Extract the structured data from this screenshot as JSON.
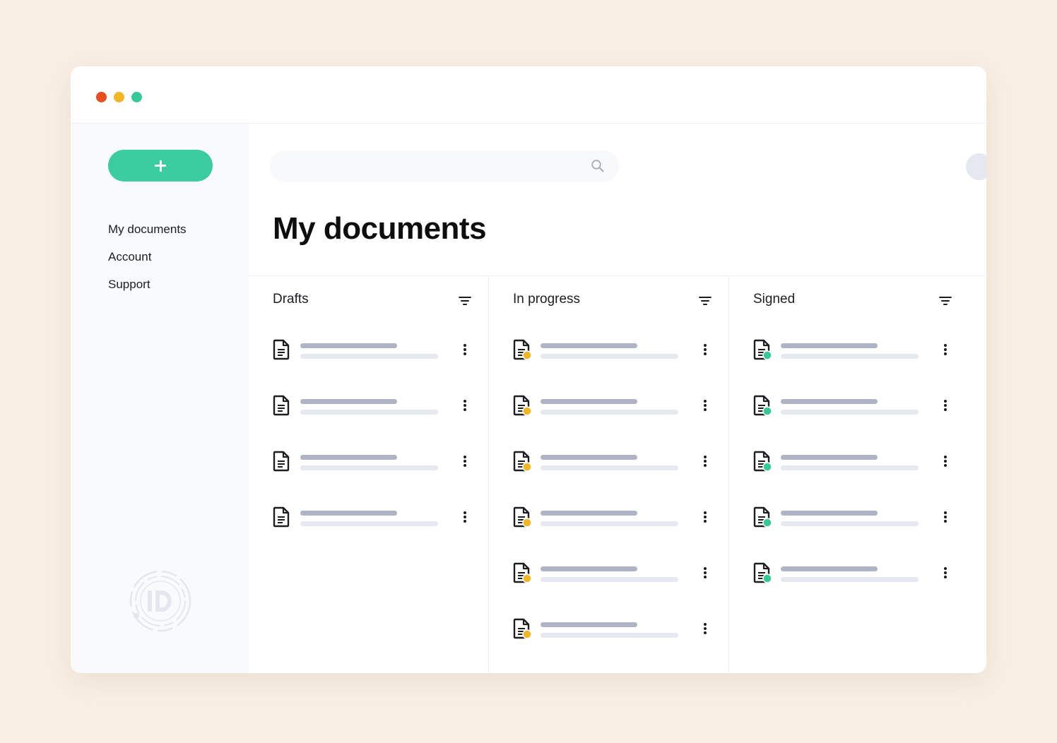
{
  "window": {
    "controls": [
      {
        "name": "close",
        "color": "#e84d1d"
      },
      {
        "name": "minimize",
        "color": "#f0b623"
      },
      {
        "name": "maximize",
        "color": "#35c997"
      }
    ]
  },
  "sidebar": {
    "new_button_icon": "plus-icon",
    "items": [
      {
        "label": "My documents"
      },
      {
        "label": "Account"
      },
      {
        "label": "Support"
      }
    ],
    "logo_icon": "id-logo-icon"
  },
  "header": {
    "search": {
      "placeholder": "",
      "value": "",
      "icon": "search-icon"
    },
    "notification_color": "#e84d1d"
  },
  "main": {
    "title": "My documents",
    "columns": [
      {
        "title": "Drafts",
        "status": "draft",
        "status_color": "",
        "row_count": 4
      },
      {
        "title": "In progress",
        "status": "in-progress",
        "status_color": "#f0b623",
        "row_count": 6
      },
      {
        "title": "Signed",
        "status": "signed",
        "status_color": "#35c997",
        "row_count": 5
      }
    ]
  },
  "colors": {
    "accent": "#3bcc9f",
    "background": "#f9efe5",
    "skeleton_dark": "#aeb3c6",
    "skeleton_light": "#e6e9f1"
  }
}
